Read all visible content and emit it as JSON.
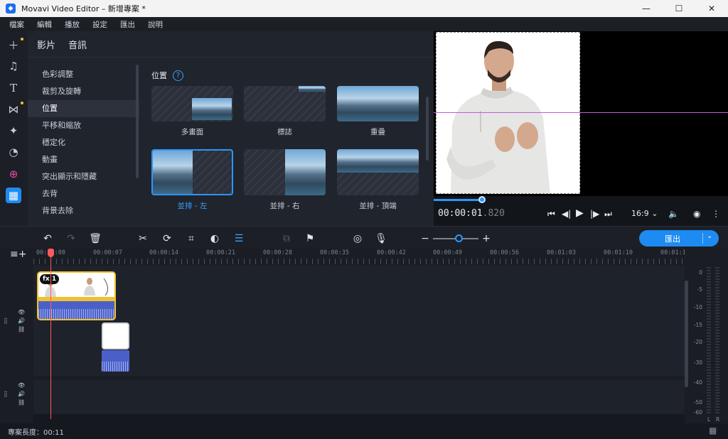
{
  "window": {
    "title": "Movavi Video Editor – 新增專案 *",
    "minimize": "—",
    "maximize": "☐",
    "close": "✕"
  },
  "menu": [
    "檔案",
    "編輯",
    "播放",
    "設定",
    "匯出",
    "說明"
  ],
  "rail": {
    "items": [
      "add-media",
      "music",
      "titles",
      "transitions",
      "stickers",
      "filters",
      "more-tools",
      "tools-active"
    ]
  },
  "panel": {
    "tabs": [
      "影片",
      "音訊"
    ],
    "categories": [
      "色彩調整",
      "裁剪及旋轉",
      "位置",
      "平移和縮放",
      "穩定化",
      "動畫",
      "突出顯示和隱藏",
      "去背",
      "背景去除"
    ],
    "active_category": "位置",
    "gallery_title": "位置",
    "help_symbol": "?",
    "presets": [
      "多畫面",
      "標誌",
      "重疊",
      "並排 - 左",
      "並排 - 右",
      "並排 - 頂端"
    ],
    "selected_preset": "並排 - 左"
  },
  "player": {
    "timecode_main": "00:00:01",
    "timecode_ms": ".820",
    "aspect_ratio": "16:9",
    "progress_fraction": 0.16
  },
  "toolbar": {
    "export_label": "匯出",
    "zoom_minus": "−",
    "zoom_plus": "+",
    "zoom_fraction": 0.55
  },
  "timeline": {
    "ruler": [
      "00:00:00",
      "00:00:07",
      "00:00:14",
      "00:00:21",
      "00:00:28",
      "00:00:35",
      "00:00:42",
      "00:00:49",
      "00:00:56",
      "00:01:03",
      "00:01:10",
      "00:01:1"
    ],
    "clip_badge_fx": "fx",
    "clip_badge_count": "1"
  },
  "meter": {
    "labels": [
      "0",
      "-5",
      "-10",
      "-15",
      "-20",
      "-30",
      "-40",
      "-50",
      "-60"
    ],
    "left_channel": "L",
    "right_channel": "R"
  },
  "status": {
    "project_length": "專案長度：00:11"
  },
  "colors": {
    "accent": "#1d8bf1",
    "clip_border": "#f0c030",
    "playhead": "#ff5a5a",
    "guide_line": "#c05cd6"
  }
}
